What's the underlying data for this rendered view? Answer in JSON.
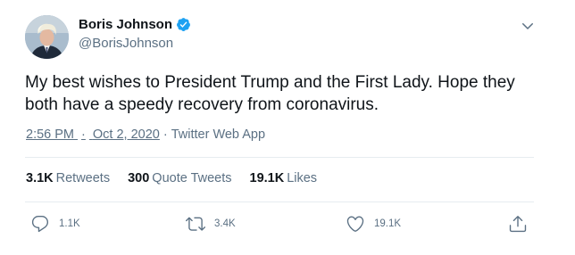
{
  "author": {
    "name": "Boris Johnson",
    "handle": "@BorisJohnson",
    "verified": true
  },
  "tweet": {
    "text": "My best wishes to President Trump and the First Lady. Hope they both have a speedy recovery from coronavirus.",
    "time": "2:56 PM",
    "date": "Oct 2, 2020",
    "source": "Twitter Web App",
    "separator": "·"
  },
  "stats": {
    "retweets": {
      "value": "3.1K",
      "label": "Retweets"
    },
    "quote_tweets": {
      "value": "300",
      "label": "Quote Tweets"
    },
    "likes": {
      "value": "19.1K",
      "label": "Likes"
    }
  },
  "actions": {
    "reply": {
      "count": "1.1K",
      "icon": "reply-icon"
    },
    "retweet": {
      "count": "3.4K",
      "icon": "retweet-icon"
    },
    "like": {
      "count": "19.1K",
      "icon": "heart-icon"
    },
    "share": {
      "icon": "share-icon"
    }
  },
  "colors": {
    "text": "#0f1419",
    "secondary": "#5b7083",
    "verified": "#1da1f2",
    "divider": "#e6ecf0"
  }
}
